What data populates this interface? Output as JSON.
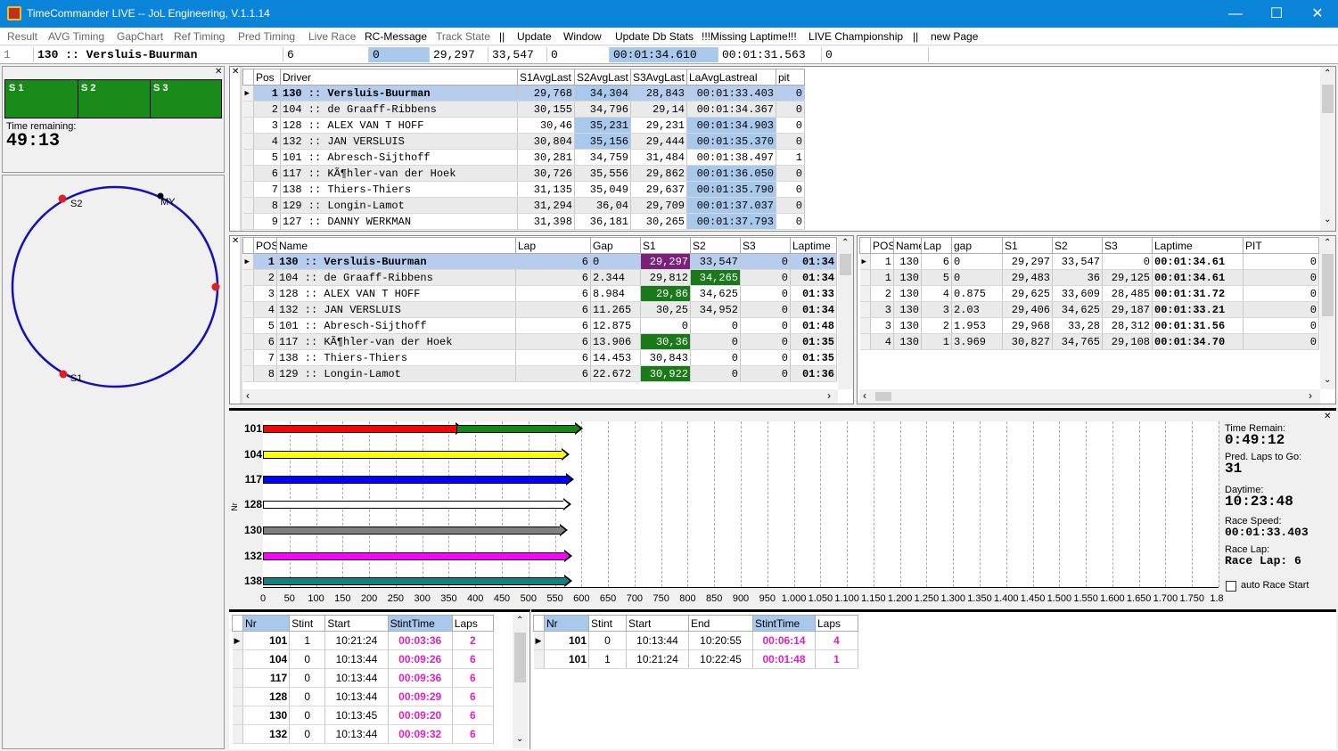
{
  "window": {
    "title": "TimeCommander LIVE -- JoL Engineering, V.1.1.14"
  },
  "menu": [
    "Result",
    "AVG Timing",
    "GapChart",
    "Ref Timing",
    "Pred Timing",
    "Live Race",
    "RC-Message",
    "Track State",
    "||",
    "Update",
    "Window",
    "Update Db Stats",
    "!!!Missing Laptime!!!",
    "LIVE Championship",
    "||",
    "new Page"
  ],
  "status": {
    "pos": "1",
    "driver": "130 :: Versluis-Buurman",
    "lap": "6",
    "gap": "0",
    "s1": "29,297",
    "s2": "33,547",
    "s3": "0",
    "last": "00:01:34.610",
    "best": "00:01:31.563",
    "pit": "0"
  },
  "sectors": {
    "labels": [
      "S 1",
      "S 2",
      "S 3"
    ],
    "time_remaining_label": "Time remaining:",
    "time_remaining": "49:13"
  },
  "track": {
    "labels": [
      "S2",
      "MY",
      "S1"
    ]
  },
  "avg_table": {
    "headers": [
      "Pos",
      "Driver",
      "S1AvgLast",
      "S2AvgLast",
      "S3AvgLast",
      "LaAvgLastreal",
      "pit"
    ],
    "rows": [
      [
        "1",
        "130 :: Versluis-Buurman",
        "29,768",
        "34,304",
        "28,843",
        "00:01:33.403",
        "0"
      ],
      [
        "2",
        "104 :: de Graaff-Ribbens",
        "30,155",
        "34,796",
        "29,14",
        "00:01:34.367",
        "0"
      ],
      [
        "3",
        "128 :: ALEX VAN T HOFF",
        "30,46",
        "35,231",
        "29,231",
        "00:01:34.903",
        "0"
      ],
      [
        "4",
        "132 :: JAN VERSLUIS",
        "30,804",
        "35,156",
        "29,444",
        "00:01:35.370",
        "0"
      ],
      [
        "5",
        "101 :: Abresch-Sijthoff",
        "30,281",
        "34,759",
        "31,484",
        "00:01:38.497",
        "1"
      ],
      [
        "6",
        "117 :: KÃ¶hler-van der Hoek",
        "30,726",
        "35,556",
        "29,862",
        "00:01:36.050",
        "0"
      ],
      [
        "7",
        "138 :: Thiers-Thiers",
        "31,135",
        "35,049",
        "29,637",
        "00:01:35.790",
        "0"
      ],
      [
        "8",
        "129 :: Longin-Lamot",
        "31,294",
        "36,04",
        "29,709",
        "00:01:37.037",
        "0"
      ],
      [
        "9",
        "127 :: DANNY WERKMAN",
        "31,398",
        "36,181",
        "30,265",
        "00:01:37.793",
        "0"
      ]
    ]
  },
  "race_table": {
    "headers": [
      "POS",
      "Name",
      "Lap",
      "Gap",
      "S1",
      "S2",
      "S3",
      "Laptime"
    ],
    "rows": [
      [
        "1",
        "130 :: Versluis-Buurman",
        "6",
        "0",
        "29,297",
        "33,547",
        "0",
        "01:34"
      ],
      [
        "2",
        "104 :: de Graaff-Ribbens",
        "6",
        "2.344",
        "29,812",
        "34,265",
        "0",
        "01:34"
      ],
      [
        "3",
        "128 :: ALEX VAN T HOFF",
        "6",
        "8.984",
        "29,86",
        "34,625",
        "0",
        "01:33"
      ],
      [
        "4",
        "132 :: JAN VERSLUIS",
        "6",
        "11.265",
        "30,25",
        "34,952",
        "0",
        "01:34"
      ],
      [
        "5",
        "101 :: Abresch-Sijthoff",
        "6",
        "12.875",
        "0",
        "0",
        "0",
        "01:48"
      ],
      [
        "6",
        "117 :: KÃ¶hler-van der Hoek",
        "6",
        "13.906",
        "30,36",
        "0",
        "0",
        "01:35"
      ],
      [
        "7",
        "138 :: Thiers-Thiers",
        "6",
        "14.453",
        "30,843",
        "0",
        "0",
        "01:35"
      ],
      [
        "8",
        "129 :: Longin-Lamot",
        "6",
        "22.672",
        "30,922",
        "0",
        "0",
        "01:36"
      ]
    ]
  },
  "lap_table": {
    "headers": [
      "POS",
      "Name",
      "Lap",
      "gap",
      "S1",
      "S2",
      "S3",
      "Laptime",
      "PIT"
    ],
    "rows": [
      [
        "1",
        "130",
        "6",
        "0",
        "29,297",
        "33,547",
        "0",
        "00:01:34.61",
        "0"
      ],
      [
        "1",
        "130",
        "5",
        "0",
        "29,483",
        "36",
        "29,125",
        "00:01:34.61",
        "0"
      ],
      [
        "2",
        "130",
        "4",
        "0.875",
        "29,625",
        "33,609",
        "28,485",
        "00:01:31.72",
        "0"
      ],
      [
        "3",
        "130",
        "3",
        "2.03",
        "29,406",
        "34,625",
        "29,187",
        "00:01:33.21",
        "0"
      ],
      [
        "3",
        "130",
        "2",
        "1.953",
        "29,968",
        "33,28",
        "28,312",
        "00:01:31.56",
        "0"
      ],
      [
        "4",
        "130",
        "1",
        "3.969",
        "30,827",
        "34,765",
        "29,108",
        "00:01:34.70",
        "0"
      ]
    ]
  },
  "gap_chart": {
    "rows": [
      {
        "nr": "101",
        "segments": [
          {
            "from": 0,
            "to": 365,
            "color": "#ff0000"
          },
          {
            "from": 365,
            "to": 590,
            "color": "#118811"
          }
        ]
      },
      {
        "nr": "104",
        "segments": [
          {
            "from": 0,
            "to": 565,
            "color": "#ffff00"
          }
        ]
      },
      {
        "nr": "117",
        "segments": [
          {
            "from": 0,
            "to": 572,
            "color": "#0000ff"
          }
        ]
      },
      {
        "nr": "128",
        "segments": [
          {
            "from": 0,
            "to": 568,
            "color": "#ffffff"
          }
        ]
      },
      {
        "nr": "130",
        "segments": [
          {
            "from": 0,
            "to": 560,
            "color": "#808080"
          }
        ]
      },
      {
        "nr": "132",
        "segments": [
          {
            "from": 0,
            "to": 570,
            "color": "#ff00ff"
          }
        ]
      },
      {
        "nr": "138",
        "segments": [
          {
            "from": 0,
            "to": 570,
            "color": "#118080"
          }
        ]
      }
    ],
    "axis_side_label": "Nr",
    "x_ticks": [
      "0",
      "50",
      "100",
      "150",
      "200",
      "250",
      "300",
      "350",
      "400",
      "450",
      "500",
      "550",
      "600",
      "650",
      "700",
      "750",
      "800",
      "850",
      "900",
      "950",
      "1.000",
      "1.050",
      "1.100",
      "1.150",
      "1.200",
      "1.250",
      "1.300",
      "1.350",
      "1.400",
      "1.450",
      "1.500",
      "1.550",
      "1.600",
      "1.650",
      "1.700",
      "1.750",
      "1.8"
    ]
  },
  "race_info": {
    "time_remain_label": "Time Remain:",
    "time_remain": "0:49:12",
    "pred_laps_label": "Pred. Laps to Go:",
    "pred_laps": "31",
    "daytime_label": "Daytime:",
    "daytime": "10:23:48",
    "race_speed_label": "Race Speed:",
    "race_speed": "00:01:33.403",
    "race_lap_label": "Race Lap:",
    "race_lap": "Race Lap: 6",
    "auto_start_label": "auto Race Start"
  },
  "stint_table": {
    "headers": [
      "Nr",
      "Stint",
      "Start",
      "StintTime",
      "Laps"
    ],
    "rows": [
      [
        "101",
        "1",
        "10:21:24",
        "00:03:36",
        "2"
      ],
      [
        "104",
        "0",
        "10:13:44",
        "00:09:26",
        "6"
      ],
      [
        "117",
        "0",
        "10:13:44",
        "00:09:36",
        "6"
      ],
      [
        "128",
        "0",
        "10:13:44",
        "00:09:29",
        "6"
      ],
      [
        "130",
        "0",
        "10:13:45",
        "00:09:20",
        "6"
      ],
      [
        "132",
        "0",
        "10:13:44",
        "00:09:32",
        "6"
      ]
    ]
  },
  "stint_detail": {
    "headers": [
      "Nr",
      "Stint",
      "Start",
      "End",
      "StintTime",
      "Laps"
    ],
    "rows": [
      [
        "101",
        "0",
        "10:13:44",
        "10:20:55",
        "00:06:14",
        "4"
      ],
      [
        "101",
        "1",
        "10:21:24",
        "10:22:45",
        "00:01:48",
        "1"
      ]
    ]
  }
}
